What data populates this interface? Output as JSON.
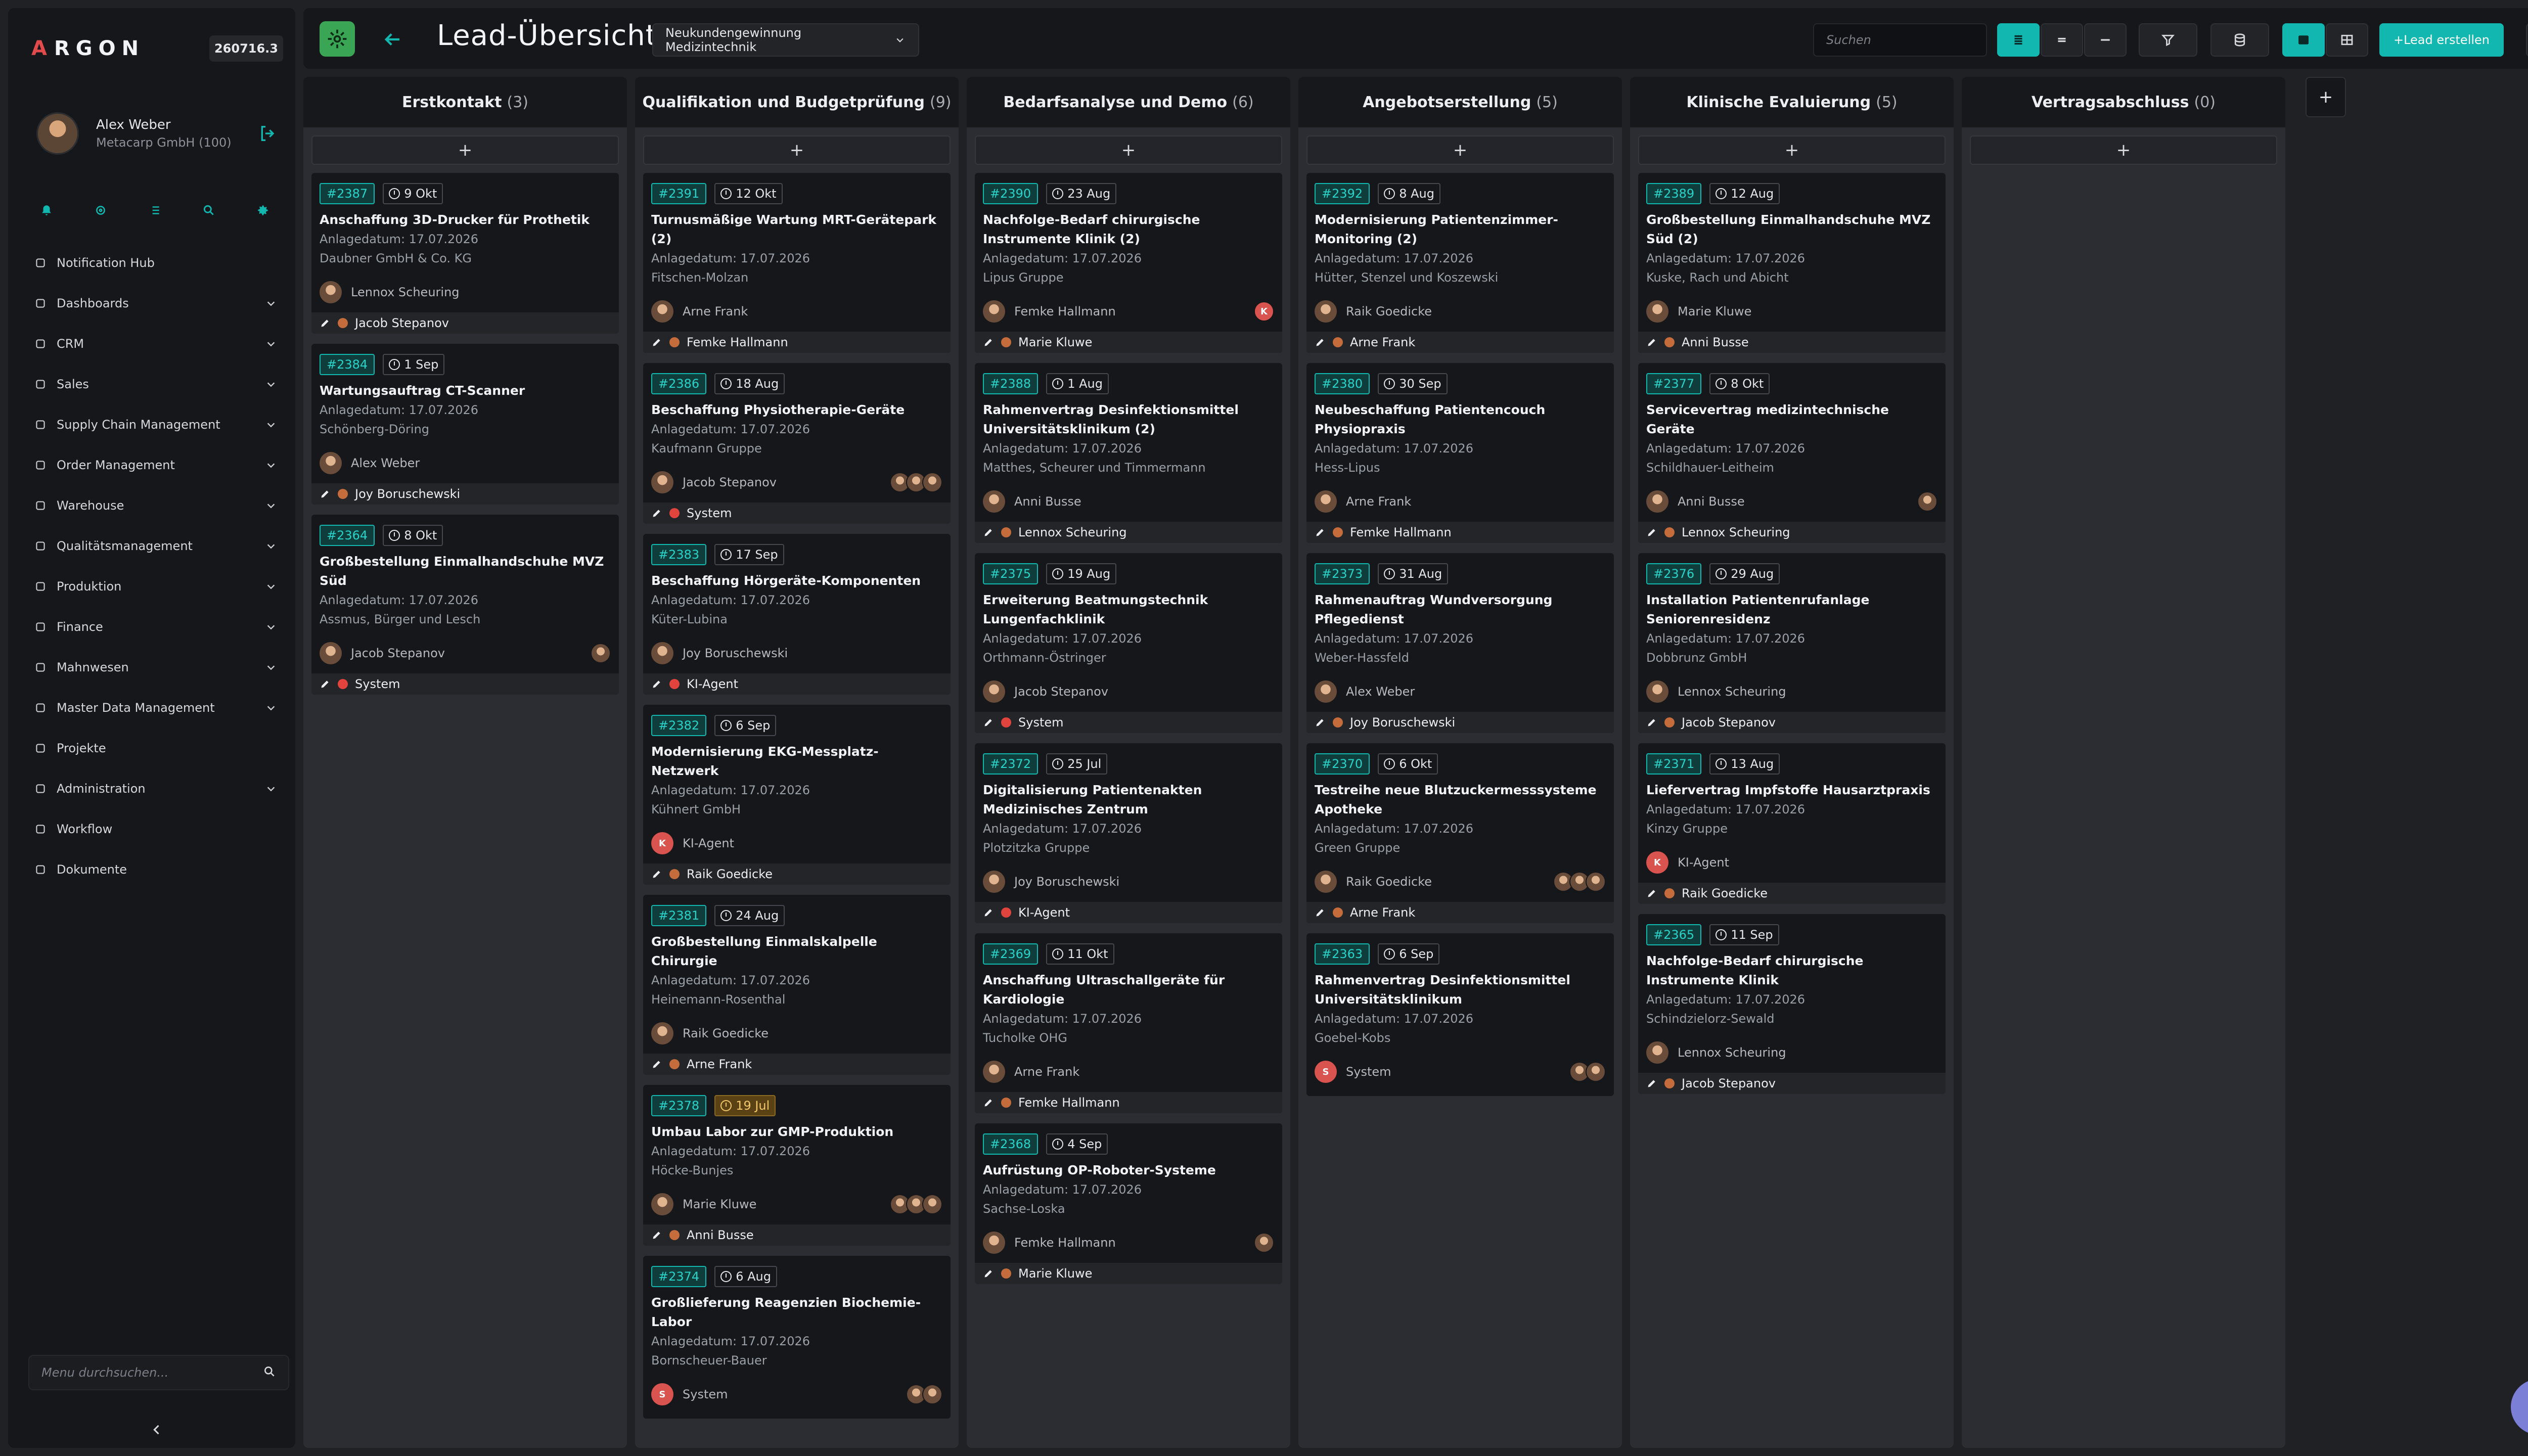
{
  "app": {
    "logo_letter": "A",
    "logo_rest": "RGON",
    "version": "260716.3"
  },
  "user": {
    "name": "Alex Weber",
    "company": "Metacarp GmbH (100)"
  },
  "quick_icons": [
    "bell-icon",
    "settings-circle-icon",
    "list-icon",
    "search-icon",
    "gear-icon"
  ],
  "nav": [
    {
      "label": "Notification Hub",
      "icon": "home-icon",
      "chev": false
    },
    {
      "label": "Dashboards",
      "icon": "dashboard-icon",
      "chev": true
    },
    {
      "label": "CRM",
      "icon": "users-icon",
      "chev": true
    },
    {
      "label": "Sales",
      "icon": "tag-icon",
      "chev": true
    },
    {
      "label": "Supply Chain Management",
      "icon": "network-icon",
      "chev": true
    },
    {
      "label": "Order Management",
      "icon": "cart-icon",
      "chev": true
    },
    {
      "label": "Warehouse",
      "icon": "warehouse-icon",
      "chev": true
    },
    {
      "label": "Qualitätsmanagement",
      "icon": "checklist-icon",
      "chev": true
    },
    {
      "label": "Produktion",
      "icon": "folder-icon",
      "chev": true
    },
    {
      "label": "Finance",
      "icon": "finance-icon",
      "chev": true
    },
    {
      "label": "Mahnwesen",
      "icon": "mail-icon",
      "chev": true
    },
    {
      "label": "Master Data Management",
      "icon": "database-icon",
      "chev": true
    },
    {
      "label": "Projekte",
      "icon": "bulb-icon",
      "chev": false
    },
    {
      "label": "Administration",
      "icon": "shield-icon",
      "chev": true
    },
    {
      "label": "Workflow",
      "icon": "workflow-icon",
      "chev": false
    },
    {
      "label": "Dokumente",
      "icon": "document-icon",
      "chev": false
    }
  ],
  "menu_search": {
    "placeholder": "Menu durchsuchen..."
  },
  "topbar": {
    "title": "Lead-Übersicht",
    "pipeline": "Neukundengewinnung Medizintechnik",
    "search_placeholder": "Suchen",
    "create_label": "+Lead erstellen"
  },
  "colors": {
    "accent": "#12b8b0",
    "sidebar": "#16171a",
    "column": "#2b2d32",
    "warning": "#f2c76b",
    "ki": "#d9534f"
  },
  "columns": [
    {
      "title": "Erstkontakt",
      "count": "(3)",
      "cards": [
        {
          "id": "#2387",
          "date": "9 Okt",
          "title": "Anschaffung 3D-Drucker für Prothetik",
          "created": "Anlagedatum: 17.07.2026",
          "company": "Daubner GmbH & Co. KG",
          "contact": "Lennox Scheuring",
          "avatars": 0,
          "owner": "Jacob Stepanov",
          "dot": "avatar"
        },
        {
          "id": "#2384",
          "date": "1 Sep",
          "title": "Wartungsauftrag CT-Scanner",
          "created": "Anlagedatum: 17.07.2026",
          "company": "Schönberg-Döring",
          "contact": "Alex Weber",
          "avatars": 0,
          "owner": "Joy Boruschewski",
          "dot": "avatar"
        },
        {
          "id": "#2364",
          "date": "8 Okt",
          "title": "Großbestellung Einmalhandschuhe MVZ Süd",
          "created": "Anlagedatum: 17.07.2026",
          "company": "Assmus, Bürger und Lesch",
          "contact": "Jacob Stepanov",
          "avatars": 1,
          "owner": "System",
          "dot": "red"
        }
      ]
    },
    {
      "title": "Qualifikation und Budgetprüfung",
      "count": "(9)",
      "cards": [
        {
          "id": "#2391",
          "date": "12 Okt",
          "title": "Turnusmäßige Wartung MRT-Gerätepark (2)",
          "created": "Anlagedatum: 17.07.2026",
          "company": "Fitschen-Molzan",
          "contact": "Arne Frank",
          "avatars": 0,
          "owner": "Femke Hallmann",
          "dot": "avatar"
        },
        {
          "id": "#2386",
          "date": "18 Aug",
          "title": "Beschaffung Physiotherapie-Geräte",
          "created": "Anlagedatum: 17.07.2026",
          "company": "Kaufmann Gruppe",
          "contact": "Jacob Stepanov",
          "avatars": 3,
          "owner": "System",
          "dot": "red"
        },
        {
          "id": "#2383",
          "date": "17 Sep",
          "title": "Beschaffung Hörgeräte-Komponenten",
          "created": "Anlagedatum: 17.07.2026",
          "company": "Küter-Lubina",
          "contact": "Joy Boruschewski",
          "avatars": 0,
          "owner": "KI-Agent",
          "dot": "red"
        },
        {
          "id": "#2382",
          "date": "6 Sep",
          "title": "Modernisierung EKG-Messplatz-Netzwerk",
          "created": "Anlagedatum: 17.07.2026",
          "company": "Kühnert GmbH",
          "contact": "KI-Agent",
          "ki": true,
          "avatars": 0,
          "owner": "Raik Goedicke",
          "dot": "avatar"
        },
        {
          "id": "#2381",
          "date": "24 Aug",
          "title": "Großbestellung Einmalskalpelle Chirurgie",
          "created": "Anlagedatum: 17.07.2026",
          "company": "Heinemann-Rosenthal",
          "contact": "Raik Goedicke",
          "avatars": 0,
          "owner": "Arne Frank",
          "dot": "avatar"
        },
        {
          "id": "#2378",
          "date": "19 Jul",
          "warn": true,
          "title": "Umbau Labor zur GMP-Produktion",
          "created": "Anlagedatum: 17.07.2026",
          "company": "Höcke-Bunjes",
          "contact": "Marie Kluwe",
          "avatars": 3,
          "owner": "Anni Busse",
          "dot": "avatar"
        },
        {
          "id": "#2374",
          "date": "6 Aug",
          "title": "Großlieferung Reagenzien Biochemie-Labor",
          "created": "Anlagedatum: 17.07.2026",
          "company": "Bornscheuer-Bauer",
          "contact": "System",
          "ki": true,
          "avatars": 2,
          "owner": "",
          "dot": "none"
        }
      ]
    },
    {
      "title": "Bedarfsanalyse und Demo",
      "count": "(6)",
      "cards": [
        {
          "id": "#2390",
          "date": "23 Aug",
          "title": "Nachfolge-Bedarf chirurgische Instrumente Klinik (2)",
          "created": "Anlagedatum: 17.07.2026",
          "company": "Lipus Gruppe",
          "contact": "Femke Hallmann",
          "avatars": 0,
          "kiBadge": true,
          "owner": "Marie Kluwe",
          "dot": "avatar"
        },
        {
          "id": "#2388",
          "date": "1 Aug",
          "title": "Rahmenvertrag Desinfektionsmittel Universitätsklinikum (2)",
          "created": "Anlagedatum: 17.07.2026",
          "company": "Matthes, Scheurer und Timmermann",
          "contact": "Anni Busse",
          "avatars": 0,
          "owner": "Lennox Scheuring",
          "dot": "avatar"
        },
        {
          "id": "#2375",
          "date": "19 Aug",
          "title": "Erweiterung Beatmungstechnik Lungenfachklinik",
          "created": "Anlagedatum: 17.07.2026",
          "company": "Orthmann-Östringer",
          "contact": "Jacob Stepanov",
          "avatars": 0,
          "owner": "System",
          "dot": "red"
        },
        {
          "id": "#2372",
          "date": "25 Jul",
          "title": "Digitalisierung Patientenakten Medizinisches Zentrum",
          "created": "Anlagedatum: 17.07.2026",
          "company": "Plotzitzka Gruppe",
          "contact": "Joy Boruschewski",
          "avatars": 0,
          "owner": "KI-Agent",
          "dot": "red"
        },
        {
          "id": "#2369",
          "date": "11 Okt",
          "title": "Anschaffung Ultraschallgeräte für Kardiologie",
          "created": "Anlagedatum: 17.07.2026",
          "company": "Tucholke OHG",
          "contact": "Arne Frank",
          "avatars": 0,
          "owner": "Femke Hallmann",
          "dot": "avatar"
        },
        {
          "id": "#2368",
          "date": "4 Sep",
          "title": "Aufrüstung OP-Roboter-Systeme",
          "created": "Anlagedatum: 17.07.2026",
          "company": "Sachse-Loska",
          "contact": "Femke Hallmann",
          "avatars": 1,
          "owner": "Marie Kluwe",
          "dot": "avatar"
        }
      ]
    },
    {
      "title": "Angebotserstellung",
      "count": "(5)",
      "cards": [
        {
          "id": "#2392",
          "date": "8 Aug",
          "title": "Modernisierung Patientenzimmer-Monitoring (2)",
          "created": "Anlagedatum: 17.07.2026",
          "company": "Hütter, Stenzel und Koszewski",
          "contact": "Raik Goedicke",
          "avatars": 0,
          "owner": "Arne Frank",
          "dot": "avatar"
        },
        {
          "id": "#2380",
          "date": "30 Sep",
          "title": "Neubeschaffung Patientencouch Physiopraxis",
          "created": "Anlagedatum: 17.07.2026",
          "company": "Hess-Lipus",
          "contact": "Arne Frank",
          "avatars": 0,
          "owner": "Femke Hallmann",
          "dot": "avatar"
        },
        {
          "id": "#2373",
          "date": "31 Aug",
          "title": "Rahmenauftrag Wundversorgung Pflegedienst",
          "created": "Anlagedatum: 17.07.2026",
          "company": "Weber-Hassfeld",
          "contact": "Alex Weber",
          "avatars": 0,
          "owner": "Joy Boruschewski",
          "dot": "avatar"
        },
        {
          "id": "#2370",
          "date": "6 Okt",
          "title": "Testreihe neue Blutzuckermesssysteme Apotheke",
          "created": "Anlagedatum: 17.07.2026",
          "company": "Green Gruppe",
          "contact": "Raik Goedicke",
          "avatars": 3,
          "owner": "Arne Frank",
          "dot": "avatar"
        },
        {
          "id": "#2363",
          "date": "6 Sep",
          "title": "Rahmenvertrag Desinfektionsmittel Universitätsklinikum",
          "created": "Anlagedatum: 17.07.2026",
          "company": "Goebel-Kobs",
          "contact": "System",
          "ki": true,
          "avatars": 2,
          "owner": "",
          "dot": "none"
        }
      ]
    },
    {
      "title": "Klinische Evaluierung",
      "count": "(5)",
      "cards": [
        {
          "id": "#2389",
          "date": "12 Aug",
          "title": "Großbestellung Einmalhandschuhe MVZ Süd (2)",
          "created": "Anlagedatum: 17.07.2026",
          "company": "Kuske, Rach und Abicht",
          "contact": "Marie Kluwe",
          "avatars": 0,
          "owner": "Anni Busse",
          "dot": "avatar"
        },
        {
          "id": "#2377",
          "date": "8 Okt",
          "title": "Servicevertrag medizintechnische Geräte",
          "created": "Anlagedatum: 17.07.2026",
          "company": "Schildhauer-Leitheim",
          "contact": "Anni Busse",
          "avatars": 1,
          "owner": "Lennox Scheuring",
          "dot": "avatar"
        },
        {
          "id": "#2376",
          "date": "29 Aug",
          "title": "Installation Patientenrufanlage Seniorenresidenz",
          "created": "Anlagedatum: 17.07.2026",
          "company": "Dobbrunz GmbH",
          "contact": "Lennox Scheuring",
          "avatars": 0,
          "owner": "Jacob Stepanov",
          "dot": "avatar"
        },
        {
          "id": "#2371",
          "date": "13 Aug",
          "title": "Liefervertrag Impfstoffe Hausarztpraxis",
          "created": "Anlagedatum: 17.07.2026",
          "company": "Kinzy Gruppe",
          "contact": "KI-Agent",
          "ki": true,
          "avatars": 0,
          "owner": "Raik Goedicke",
          "dot": "avatar"
        },
        {
          "id": "#2365",
          "date": "11 Sep",
          "title": "Nachfolge-Bedarf chirurgische Instrumente Klinik",
          "created": "Anlagedatum: 17.07.2026",
          "company": "Schindzielorz-Sewald",
          "contact": "Lennox Scheuring",
          "avatars": 0,
          "owner": "Jacob Stepanov",
          "dot": "avatar"
        }
      ]
    },
    {
      "title": "Vertragsabschluss",
      "count": "(0)",
      "cards": []
    }
  ]
}
